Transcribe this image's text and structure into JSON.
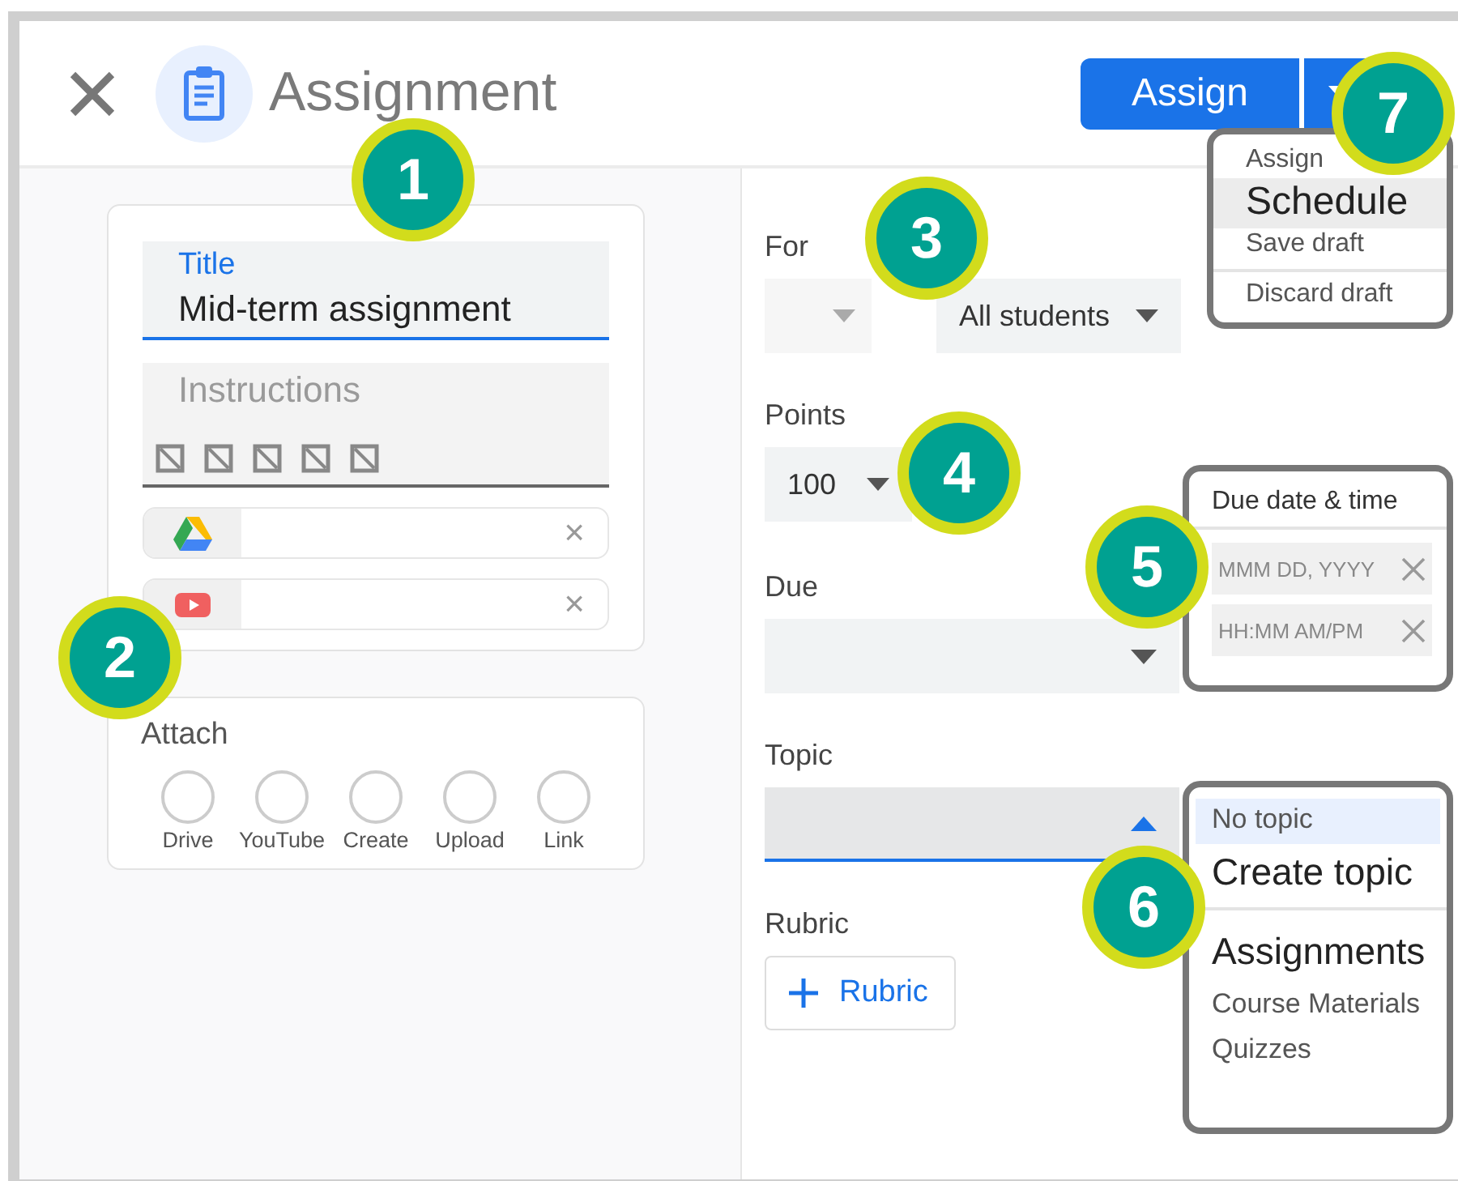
{
  "header": {
    "title": "Assignment",
    "assign_button": "Assign"
  },
  "assign_menu": {
    "groups": [
      [
        {
          "label": "Assign",
          "selected": false
        },
        {
          "label": "Schedule",
          "selected": true
        },
        {
          "label": "Save draft",
          "selected": false
        }
      ],
      [
        {
          "label": "Discard draft",
          "selected": false
        }
      ]
    ]
  },
  "title_field": {
    "label": "Title",
    "value": "Mid-term assignment"
  },
  "instructions_field": {
    "placeholder": "Instructions"
  },
  "attachments": [
    {
      "kind": "drive",
      "remove": "×"
    },
    {
      "kind": "youtube",
      "remove": "×"
    }
  ],
  "attach": {
    "label": "Attach",
    "options": [
      {
        "label": "Drive"
      },
      {
        "label": "YouTube"
      },
      {
        "label": "Create"
      },
      {
        "label": "Upload"
      },
      {
        "label": "Link"
      }
    ]
  },
  "for": {
    "label": "For",
    "students": "All students"
  },
  "points": {
    "label": "Points",
    "value": "100"
  },
  "due": {
    "label": "Due"
  },
  "due_popup": {
    "title": "Due date & time",
    "date_placeholder": "MMM DD, YYYY",
    "time_placeholder": "HH:MM AM/PM"
  },
  "topic": {
    "label": "Topic",
    "expanded": true
  },
  "topic_menu": {
    "groups": [
      [
        {
          "label": "No topic",
          "kind": "small",
          "selected": true
        },
        {
          "label": "Create topic",
          "kind": "large",
          "selected": false
        }
      ],
      [
        {
          "label": "Assignments",
          "kind": "large",
          "selected": false
        },
        {
          "label": "Course Materials",
          "kind": "small",
          "selected": false
        },
        {
          "label": "Quizzes",
          "kind": "small",
          "selected": false
        }
      ]
    ]
  },
  "rubric": {
    "label": "Rubric",
    "button": "Rubric"
  },
  "callouts": [
    {
      "number": "1"
    },
    {
      "number": "2"
    },
    {
      "number": "3"
    },
    {
      "number": "4"
    },
    {
      "number": "5"
    },
    {
      "number": "6"
    },
    {
      "number": "7"
    }
  ]
}
